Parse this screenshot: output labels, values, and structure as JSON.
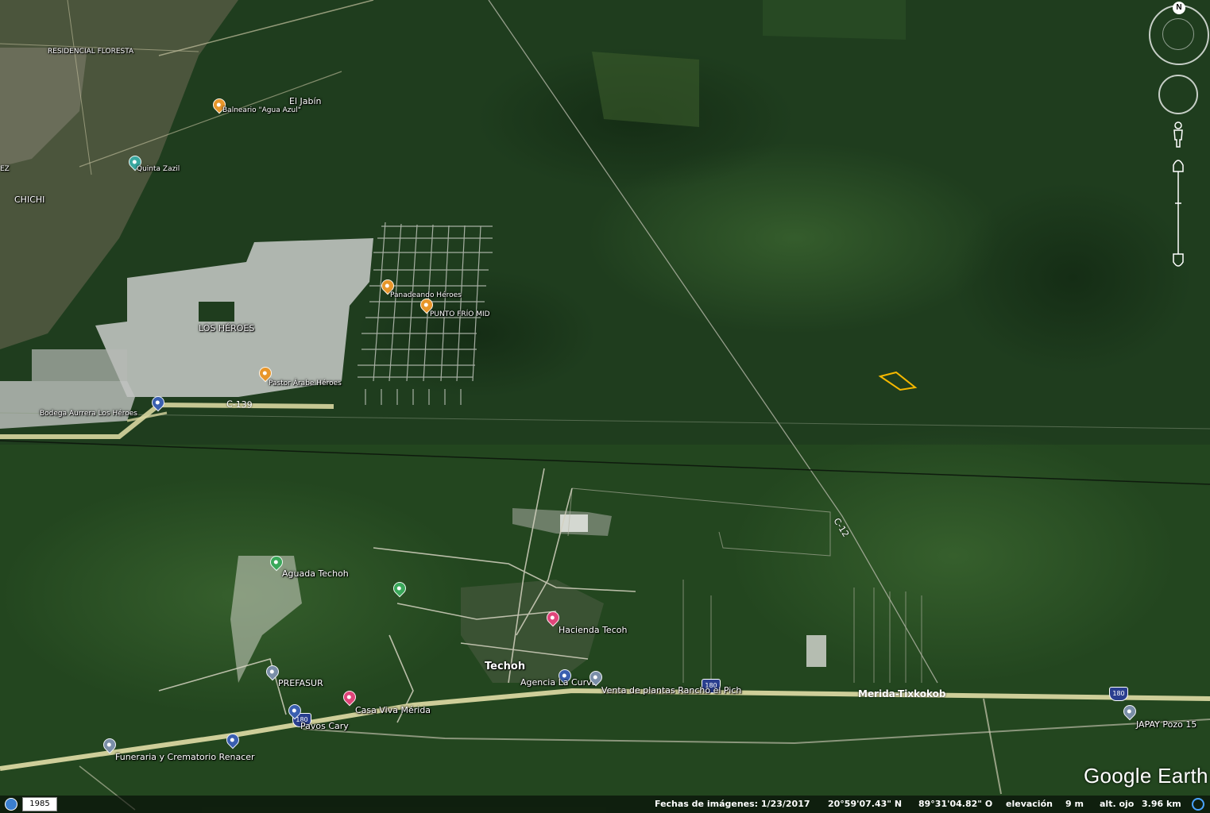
{
  "labels": {
    "residencial_floresta": "RESIDENCIAL FLORESTA",
    "el_jabin": "El Jabín",
    "balneario": "Balneario \"Agua Azul\"",
    "quinta_zazil": "Quinta Zazil",
    "chichi": "CHICHI",
    "ez": "EZ",
    "los_heroes": "LOS HÉROES",
    "panadeando": "Panadeando Héroes",
    "punto_frio": "PUNTO FRÍO MID",
    "pastor_arabe": "Pastor Árabe Héroes",
    "bodega_aurrera": "Bodega Aurrera Los Héroes",
    "aguada_techoh": "Aguada Techoh",
    "hacienda_techoh": "Hacienda Tecoh",
    "techoh": "Techoh",
    "agencia_la_curva": "Agencia La Curva",
    "venta_de_plantas": "Venta de plantas Rancho el Pich",
    "merida_tixkokob": "Merida-Tixkokob",
    "prefasur": "PREFASUR",
    "casa_viva": "Casa Viva Mérida",
    "pavos_cary": "Pavos Cary",
    "funeraria": "Funeraria y Crematorio Renacer",
    "japay": "JAPAY Pozo 15"
  },
  "roads": {
    "c139": "C-139",
    "c12": "C-12",
    "hwy180": "180"
  },
  "nav": {
    "compass_letter": "N"
  },
  "status": {
    "year": "1985",
    "imagery_date": "Fechas de imágenes: 1/23/2017",
    "latitude": "20°59'07.43\" N",
    "longitude": "89°31'04.82\" O",
    "elevation_label": "elevación",
    "elevation_value": "9 m",
    "eye_label": "alt. ojo",
    "eye_value": "3.96 km"
  },
  "brand": {
    "logo_text": "Google Earth"
  },
  "colors": {
    "forest": "#1f3d1e",
    "road": "#d8d6a0",
    "pin_orange": "#e8962a",
    "pin_green": "#3aa85a",
    "pin_pink": "#e0457a",
    "pin_blue": "#3a5fb0",
    "pin_gray": "#7a8ea8",
    "polygon": "#f5b800"
  }
}
